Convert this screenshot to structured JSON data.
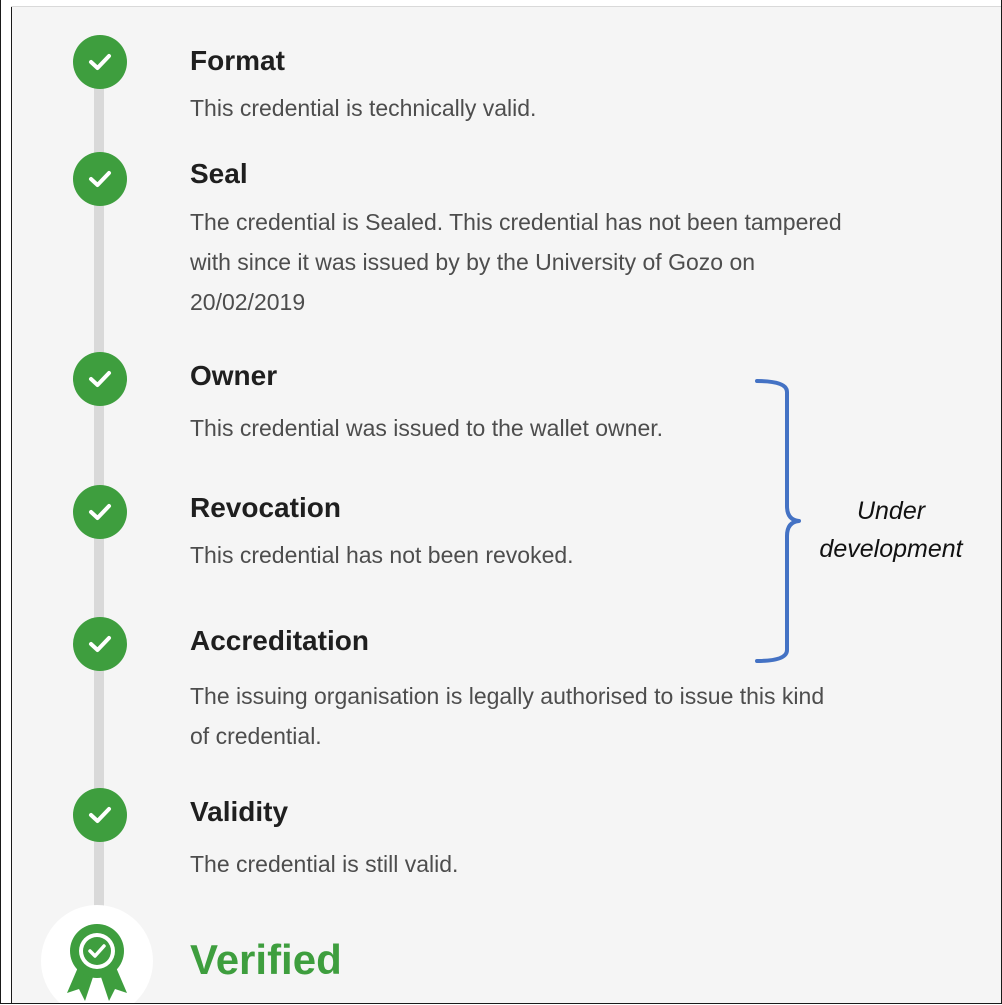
{
  "steps": [
    {
      "title": "Format",
      "desc": [
        "This credential is technically valid."
      ]
    },
    {
      "title": "Seal",
      "desc": [
        "The credential is Sealed. This credential has not been tampered",
        "with since it was issued by by the University of Gozo on",
        "20/02/2019"
      ]
    },
    {
      "title": "Owner",
      "desc": [
        "This credential was issued to the wallet owner."
      ]
    },
    {
      "title": "Revocation",
      "desc": [
        "This credential has not been revoked."
      ]
    },
    {
      "title": "Accreditation",
      "desc": [
        "The issuing organisation is legally authorised to issue this kind",
        "of credential."
      ]
    },
    {
      "title": "Validity",
      "desc": [
        "The credential is still valid."
      ]
    }
  ],
  "result": {
    "label": "Verified"
  },
  "annotation": {
    "line1": "Under",
    "line2": "development"
  },
  "colors": {
    "success": "#3e9e3e",
    "bracket": "#4472c4",
    "timeline": "#d9d9d9"
  },
  "icons": {
    "step": "check-circle-icon",
    "result": "award-badge-icon"
  }
}
